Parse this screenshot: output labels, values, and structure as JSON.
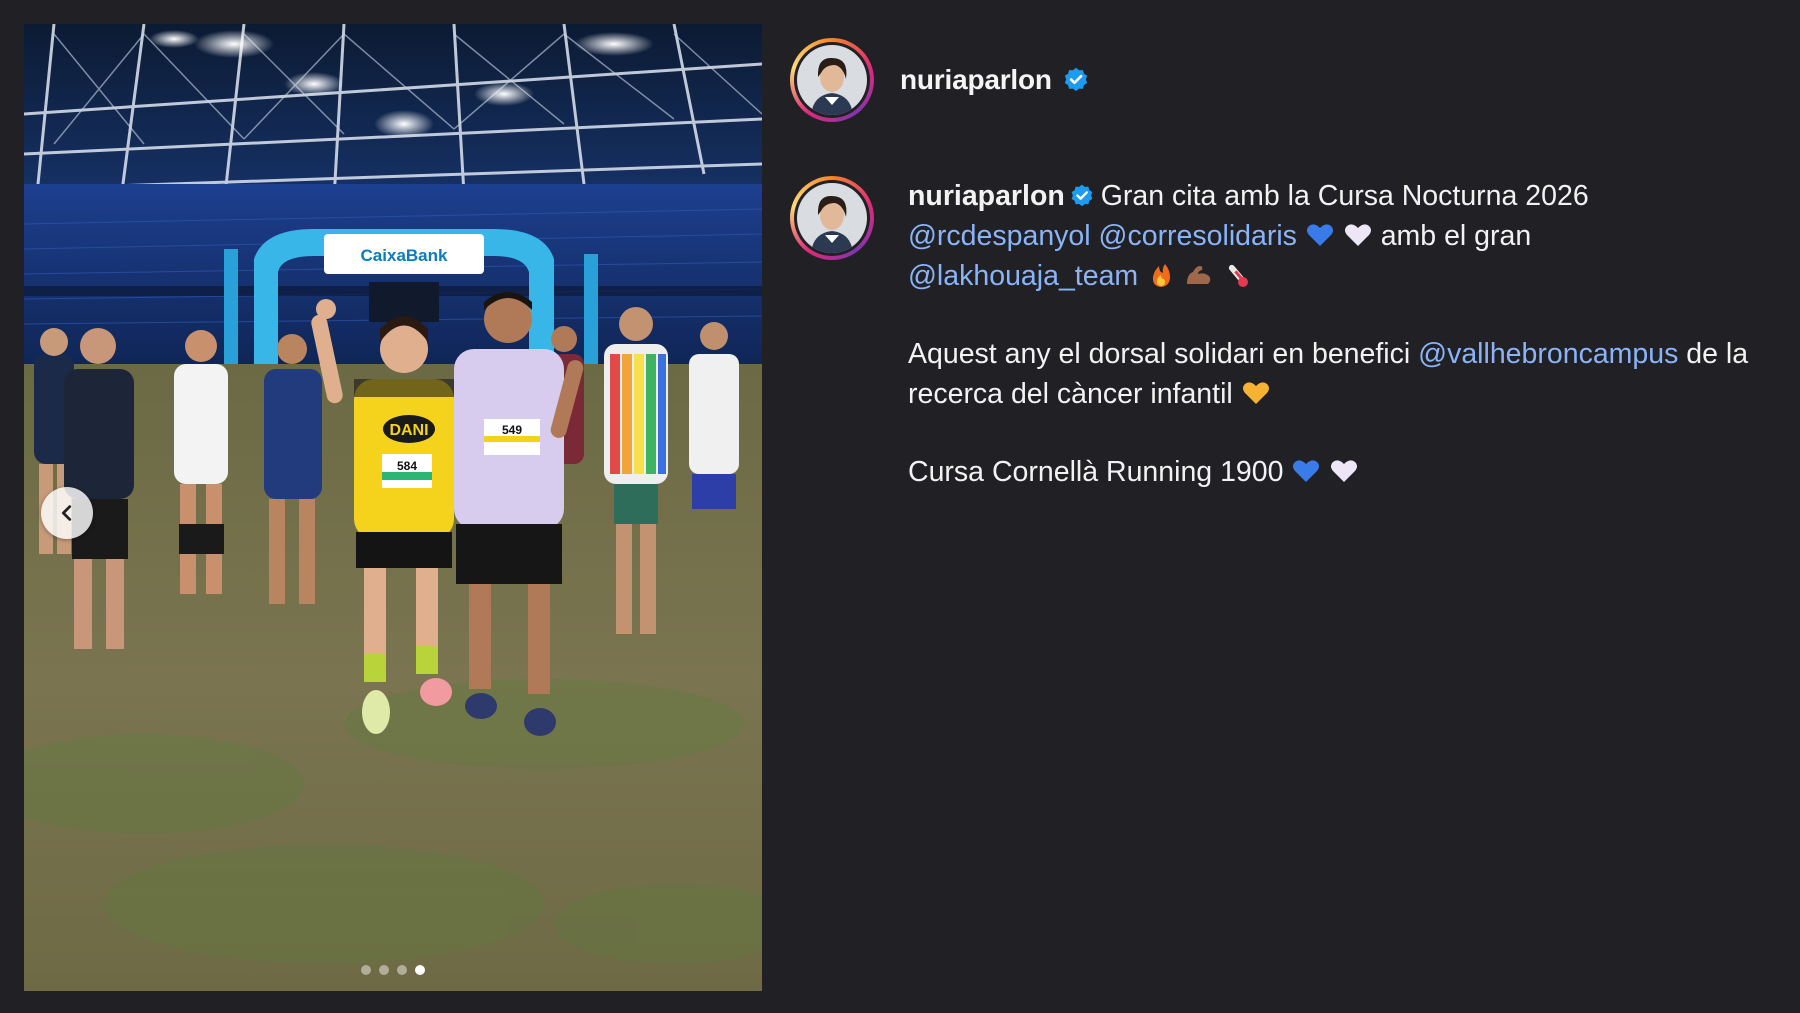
{
  "post": {
    "username": "nuriaparlon",
    "verified": true,
    "carousel": {
      "slide_count": 4,
      "active_index": 3
    }
  },
  "caption": {
    "username": "nuriaparlon",
    "line1_text": "Gran cita amb la Cursa Nocturna 2026",
    "mention_1": "@rcdespanyol",
    "mention_2": "@corresolidaris",
    "after_hearts_text": "amb el gran",
    "mention_3": "@lakhouaja_team",
    "paragraph2_text": "Aquest any el dorsal solidari en benefici",
    "mention_4": "@vallhebroncampus",
    "paragraph2_tail": "de la recerca del càncer infantil",
    "paragraph3_text": "Cursa Cornellà Running 1900"
  },
  "photo": {
    "arch_sponsor_text": "CaixaBank",
    "shirt_text": "DANI",
    "bib_number_left": "584",
    "bib_number_right": "549"
  },
  "icons": {
    "prev": "chevron-left-icon",
    "verified": "verified-badge-icon",
    "blue_heart": "blue-heart-emoji",
    "white_heart": "white-heart-emoji",
    "fire": "fire-emoji",
    "muscle": "flexed-biceps-emoji",
    "thermometer": "thermometer-emoji",
    "yellow_heart": "yellow-heart-emoji"
  },
  "colors": {
    "background": "#202025",
    "mention": "#8ab4f8",
    "verified": "#1d9bf0"
  }
}
